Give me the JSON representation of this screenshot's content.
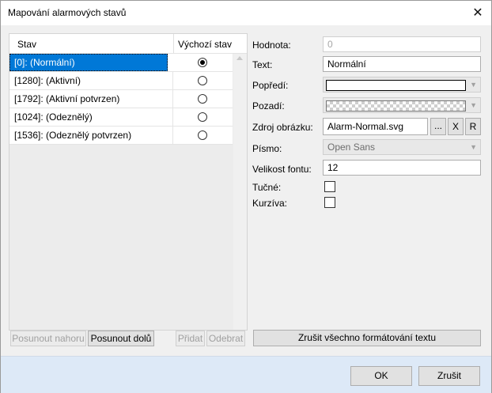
{
  "window": {
    "title": "Mapování alarmových stavů"
  },
  "icons": {
    "close": "close-icon",
    "scroll_up": "chevron-up-icon",
    "dropdown": "chevron-down-icon"
  },
  "list": {
    "headers": {
      "state": "Stav",
      "default": "Výchozí stav"
    },
    "rows": [
      {
        "label": "[0]: (Normální)",
        "default": true,
        "selected": true
      },
      {
        "label": "[1280]: (Aktivní)",
        "default": false,
        "selected": false
      },
      {
        "label": "[1792]: (Aktivní potvrzen)",
        "default": false,
        "selected": false
      },
      {
        "label": "[1024]: (Odeznělý)",
        "default": false,
        "selected": false
      },
      {
        "label": "[1536]: (Odeznělý potvrzen)",
        "default": false,
        "selected": false
      }
    ]
  },
  "buttons": {
    "move_up": "Posunout nahoru",
    "move_down": "Posunout dolů",
    "add": "Přidat",
    "remove": "Odebrat",
    "clear_format": "Zrušit všechno formátování textu",
    "browse": "...",
    "clear_image": "X",
    "reset_image": "R",
    "ok": "OK",
    "cancel": "Zrušit"
  },
  "props": {
    "value": {
      "label": "Hodnota:",
      "value": "0"
    },
    "text": {
      "label": "Text:",
      "value": "Normální"
    },
    "foreground": {
      "label": "Popředí:",
      "color": "#ffffff"
    },
    "background": {
      "label": "Pozadí:",
      "color": "transparent"
    },
    "image_source": {
      "label": "Zdroj obrázku:",
      "value": "Alarm-Normal.svg"
    },
    "font": {
      "label": "Písmo:",
      "value": "Open Sans"
    },
    "font_size": {
      "label": "Velikost fontu:",
      "value": "12"
    },
    "bold": {
      "label": "Tučné:",
      "checked": false
    },
    "italic": {
      "label": "Kurzíva:",
      "checked": false
    }
  },
  "colors": {
    "selection": "#0078d7",
    "footer": "#dde9f7",
    "panel": "#f0f0f0"
  }
}
